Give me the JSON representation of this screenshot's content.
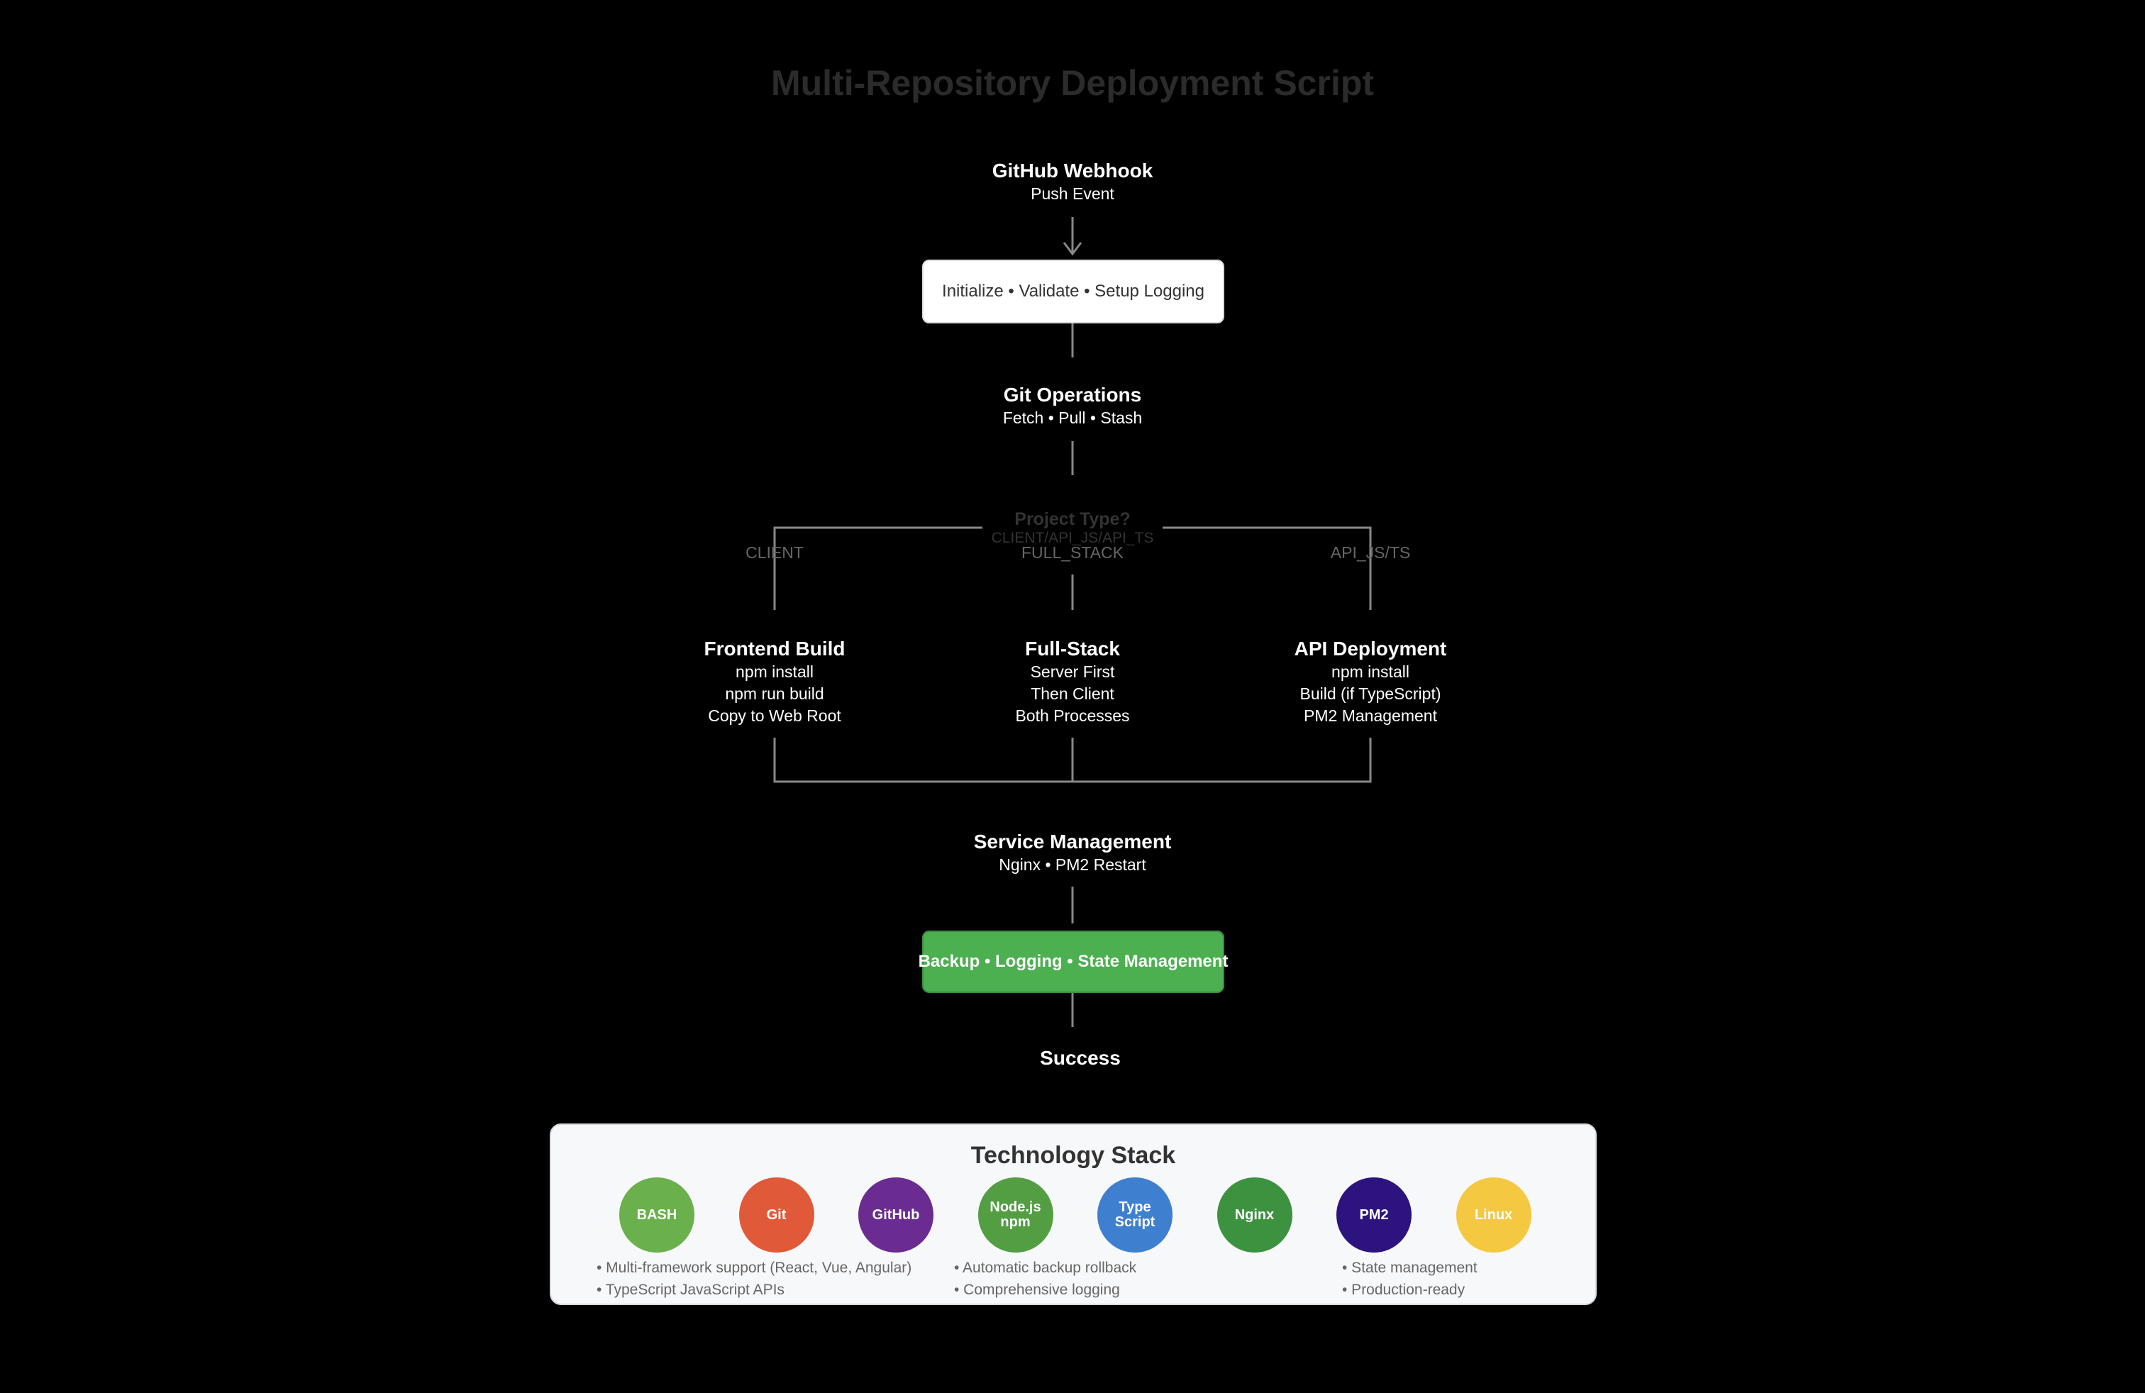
{
  "title": "Multi-Repository Deployment Script",
  "webhook": {
    "title": "GitHub Webhook",
    "sub": "Push Event"
  },
  "init_box": "Initialize • Validate • Setup Logging",
  "git_ops": {
    "title": "Git Operations",
    "sub": "Fetch • Pull • Stash"
  },
  "decision": {
    "title": "Project Type?",
    "sub": "CLIENT/API_JS/API_TS"
  },
  "branch_labels": {
    "client": "CLIENT",
    "full_stack": "FULL_STACK",
    "api": "API_JS/TS"
  },
  "frontend": {
    "title": "Frontend Build",
    "lines": [
      "npm install",
      "npm run build",
      "Copy to Web Root"
    ]
  },
  "fullstack": {
    "title": "Full-Stack",
    "lines": [
      "Server First",
      "Then Client",
      "Both Processes"
    ]
  },
  "api": {
    "title": "API Deployment",
    "lines": [
      "npm install",
      "Build (if TypeScript)",
      "PM2 Management"
    ]
  },
  "service": {
    "title": "Service Management",
    "sub": "Nginx • PM2 Restart"
  },
  "backup_box": "Backup • Logging • State Management",
  "success": "Success",
  "stack": {
    "title": "Technology Stack",
    "items": [
      {
        "label": "BASH",
        "color": "#6ab04c"
      },
      {
        "label": "Git",
        "color": "#e05a3a"
      },
      {
        "label": "GitHub",
        "color": "#6a2c91"
      },
      {
        "label": "Node.js\nnpm",
        "color": "#539e43"
      },
      {
        "label": "Type\nScript",
        "color": "#3f7fd0"
      },
      {
        "label": "Nginx",
        "color": "#3d9240"
      },
      {
        "label": "PM2",
        "color": "#2d137e"
      },
      {
        "label": "Linux",
        "color": "#f5c842"
      }
    ],
    "features_left": [
      "• Multi-framework support (React, Vue, Angular)",
      "• TypeScript JavaScript APIs"
    ],
    "features_mid": [
      "• Automatic backup rollback",
      "• Comprehensive logging"
    ],
    "features_right": [
      "• State management",
      "• Production-ready"
    ]
  },
  "colors": {
    "background": "#000000",
    "connector": "#888888",
    "box_green": "#4caf50"
  }
}
